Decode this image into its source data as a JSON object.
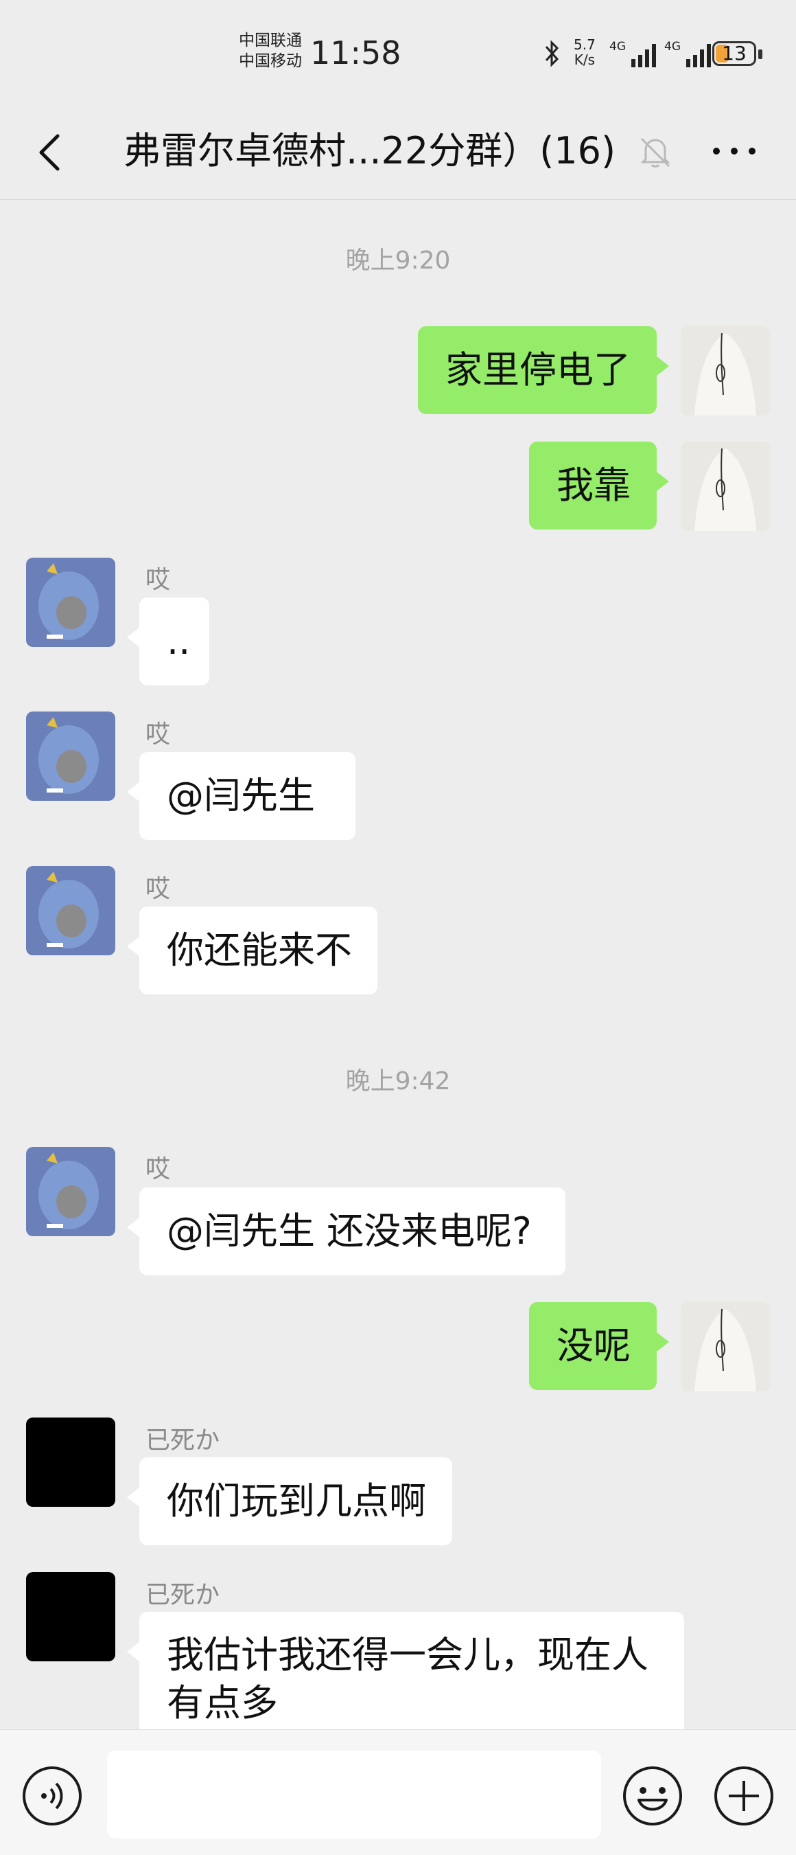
{
  "status_bar": {
    "carrier1": "中国联通",
    "carrier2": "中国移动",
    "time": "11:58",
    "speed_top": "5.7",
    "speed_bottom": "K/s",
    "network1": "4G",
    "network2": "4G",
    "battery": "13",
    "battery_level": 0.13,
    "battery_color": "#f2a23a"
  },
  "header": {
    "title": "弗雷尔卓德村...22分群）(16)",
    "back_icon": "chevron-left-icon",
    "mute_icon": "bell-off-icon",
    "more_icon": "more-horizontal-icon"
  },
  "chat": {
    "time1": "晚上9:20",
    "time2": "晚上9:42",
    "messages": [
      {
        "from": "self",
        "text": "家里停电了"
      },
      {
        "from": "self",
        "text": "我靠"
      },
      {
        "from": "other",
        "sender": "哎",
        "text": ".."
      },
      {
        "from": "other",
        "sender": "哎",
        "text": "@闫先生"
      },
      {
        "from": "other",
        "sender": "哎",
        "text": "你还能来不"
      },
      {
        "from": "other",
        "sender": "哎",
        "text": "@闫先生  还没来电呢?"
      },
      {
        "from": "self",
        "text": "没呢"
      },
      {
        "from": "other",
        "sender": "已死か",
        "text": "你们玩到几点啊"
      },
      {
        "from": "other",
        "sender": "已死か",
        "text": "我估计我还得一会儿，现在人有点多"
      }
    ],
    "last_line1": "我估计我还得一会儿，现在人",
    "last_line2": "有点多"
  },
  "input_bar": {
    "voice_icon": "voice-icon",
    "emoji_icon": "emoji-icon",
    "plus_icon": "plus-circle-icon"
  },
  "colors": {
    "self_bubble": "#95ec69",
    "other_bubble": "#ffffff",
    "background": "#ededed"
  }
}
